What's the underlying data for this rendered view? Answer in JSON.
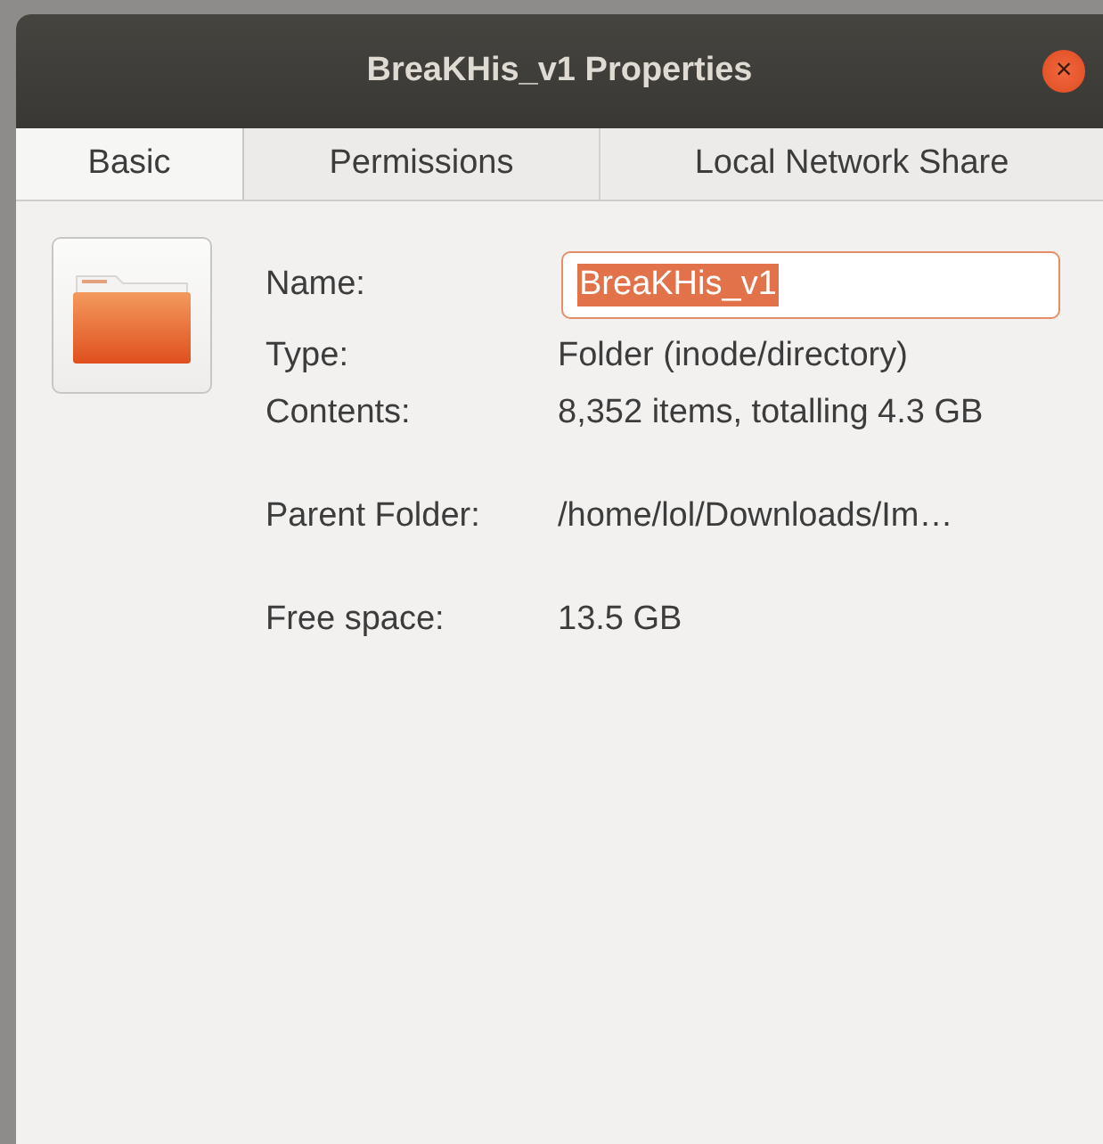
{
  "window": {
    "title": "BreaKHis_v1 Properties",
    "close_button": "×"
  },
  "tabs": [
    {
      "label": "Basic",
      "selected": true
    },
    {
      "label": "Permissions",
      "selected": false
    },
    {
      "label": "Local Network Share",
      "selected": false
    }
  ],
  "details": [
    [
      {
        "kind": "field",
        "label": "Name:",
        "value": "BreaKHis_v1",
        "text_selected": true,
        "focused": true
      },
      {
        "kind": "text",
        "label": "Type:",
        "value": "Folder (inode/directory)"
      },
      {
        "kind": "text",
        "label": "Contents:",
        "value": "8,352 items, totalling 4.3 GB"
      }
    ],
    [
      {
        "kind": "text",
        "label": "Parent Folder:",
        "value": "/home/lol/Downloads/Im…"
      }
    ],
    [
      {
        "kind": "text",
        "label": "Free space:",
        "value": "13.5 GB"
      }
    ]
  ]
}
